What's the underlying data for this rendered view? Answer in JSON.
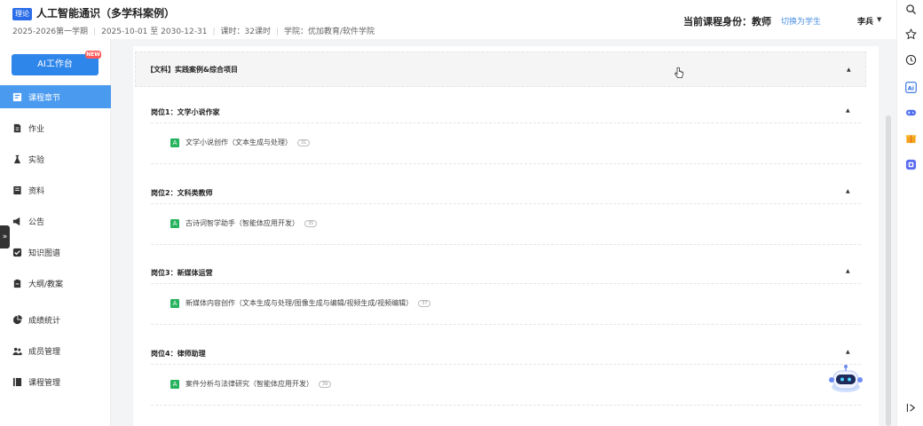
{
  "header": {
    "badge": "理论",
    "course_title": "人工智能通识（多学科案例）",
    "term": "2025-2026第一学期",
    "date_range": "2025-10-01 至 2030-12-31",
    "hours": "课时：32课时",
    "college": "学院：优加教育/软件学院",
    "identity": "当前课程身份：教师",
    "switch_role": "切换为学生",
    "user_name": "李兵"
  },
  "sidebar": {
    "ai_button": "AI工作台",
    "new_tag": "NEW",
    "items": [
      {
        "label": "课程章节",
        "icon": "chapter-icon",
        "active": true
      },
      {
        "label": "作业",
        "icon": "homework-icon"
      },
      {
        "label": "实验",
        "icon": "experiment-icon"
      },
      {
        "label": "资料",
        "icon": "materials-icon"
      },
      {
        "label": "公告",
        "icon": "announcement-icon"
      },
      {
        "label": "知识图谱",
        "icon": "knowledge-graph-icon"
      },
      {
        "label": "大纲/教案",
        "icon": "syllabus-icon"
      },
      {
        "label": "成绩统计",
        "icon": "grades-chart-icon"
      },
      {
        "label": "成员管理",
        "icon": "members-icon"
      },
      {
        "label": "课程管理",
        "icon": "course-manage-icon"
      }
    ]
  },
  "main": {
    "category": "【文科】实践案例&综合项目",
    "jobs": [
      {
        "label": "岗位1：文学小说作家",
        "lesson": "文学小说创作（文本生成与处理）",
        "count": "31"
      },
      {
        "label": "岗位2：文科类教师",
        "lesson": "古诗词智学助手（智能体应用开发）",
        "count": "35"
      },
      {
        "label": "岗位3：新媒体运营",
        "lesson": "新媒体内容创作（文本生成与处理/图像生成与编辑/视频生成/视频编辑）",
        "count": "37"
      },
      {
        "label": "岗位4：律师助理",
        "lesson": "案件分析与法律研究（智能体应用开发）",
        "count": "39"
      }
    ]
  },
  "colors": {
    "accent": "#2f86ea",
    "active_nav": "#4a9bf0",
    "lesson_icon": "#27b35d",
    "link": "#4a90e2"
  }
}
